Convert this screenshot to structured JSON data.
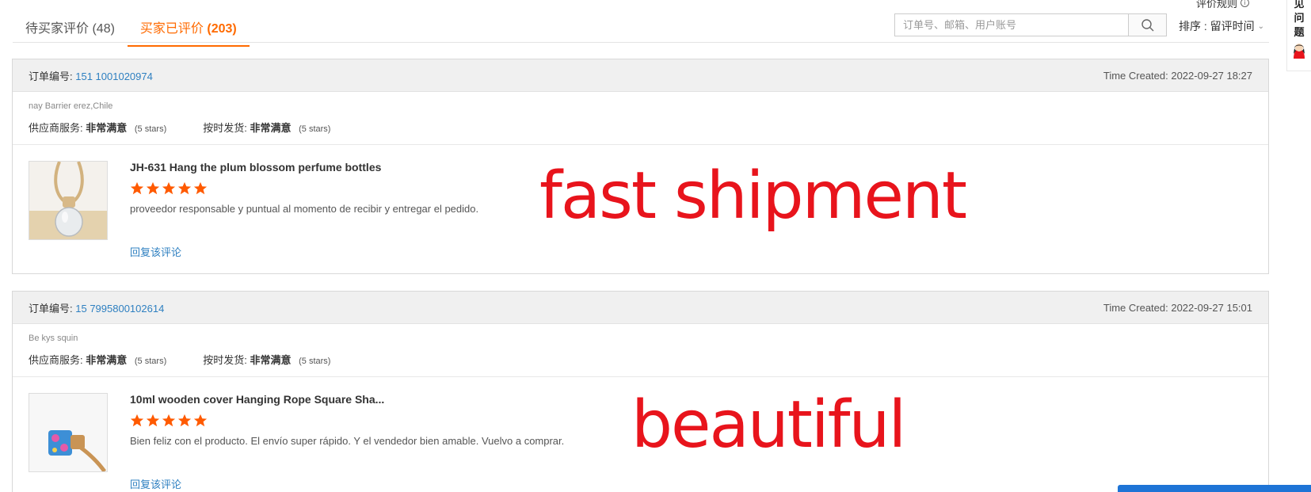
{
  "header": {
    "rules_label": "评价规则",
    "tabs": [
      {
        "label": "待买家评价",
        "count": "(48)"
      },
      {
        "label": "买家已评价",
        "count": "(203)"
      }
    ],
    "search_placeholder": "订单号、邮箱、用户账号",
    "sort_label": "排序 : 留评时间"
  },
  "side_widget": {
    "chars": [
      "见",
      "问",
      "题"
    ]
  },
  "reviews": [
    {
      "order_label": "订单编号:",
      "order_number": "151     1001020974",
      "time_created": "Time Created: 2022-09-27 18:27",
      "buyer": "  nay Barrier   erez,Chile",
      "supplier_label": "供应商服务:",
      "supplier_value": "非常满意",
      "supplier_stars": "(5 stars)",
      "ontime_label": "按时发货:",
      "ontime_value": "非常满意",
      "ontime_stars": "(5 stars)",
      "product_title": "JH-631 Hang the plum blossom perfume bottles",
      "rating": 5,
      "comment": "proveedor responsable y puntual al momento de recibir y entregar el pedido.",
      "reply_label": "回复该评论",
      "overlay": "fast shipment"
    },
    {
      "order_label": "订单编号:",
      "order_number": "15  7995800102614",
      "time_created": "Time Created: 2022-09-27 15:01",
      "buyer": "Be kys   squin",
      "supplier_label": "供应商服务:",
      "supplier_value": "非常满意",
      "supplier_stars": "(5 stars)",
      "ontime_label": "按时发货:",
      "ontime_value": "非常满意",
      "ontime_stars": "(5 stars)",
      "product_title": "10ml wooden cover Hanging Rope Square Sha...",
      "rating": 5,
      "comment": "Bien feliz con el producto.  El envío super rápido.  Y el vendedor bien amable. Vuelvo a comprar.",
      "reply_label": "回复该评论",
      "overlay": "beautiful"
    }
  ],
  "colors": {
    "accent": "#ff6a00",
    "link": "#2f80c1",
    "overlay": "#e8141c",
    "star": "#ff5a00"
  }
}
